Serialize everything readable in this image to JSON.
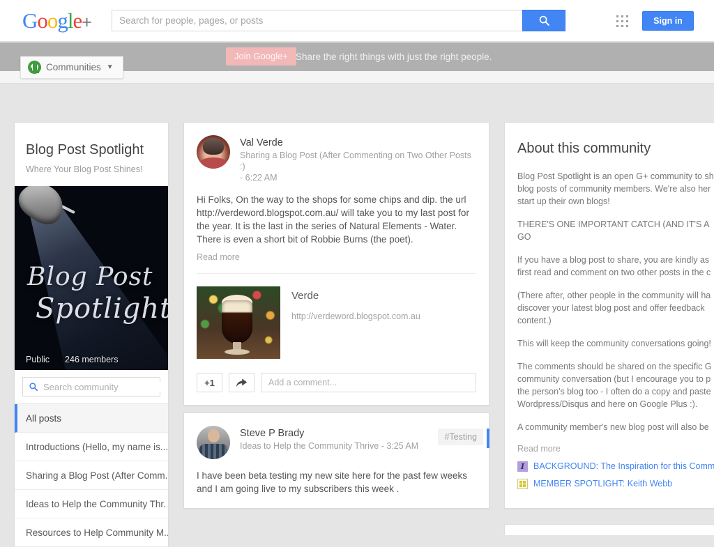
{
  "topbar": {
    "logo_text": "Google",
    "logo_plus": "+",
    "search_placeholder": "Search for people, pages, or posts",
    "search_value": "",
    "search_icon": "search-icon",
    "apps_icon": "apps-grid-icon",
    "signin_label": "Sign in"
  },
  "promo": {
    "join_label": "Join Google+",
    "message": "Share the right things with just the right people."
  },
  "subnav": {
    "communities_label": "Communities",
    "communities_icon": "communities-icon",
    "caret_icon": "chevron-down-icon"
  },
  "community": {
    "title": "Blog Post Spotlight",
    "tagline": "Where Your Blog Post Shines!",
    "banner_line1": "Blog Post",
    "banner_line2": "Spotlight",
    "visibility": "Public",
    "members": "246 members",
    "search_placeholder": "Search community",
    "search_value": "",
    "nav": [
      {
        "label": "All posts",
        "active": true
      },
      {
        "label": "Introductions (Hello, my name is....",
        "active": false
      },
      {
        "label": "Sharing a Blog Post (After Comm.",
        "active": false
      },
      {
        "label": "Ideas to Help the Community Thr.",
        "active": false
      },
      {
        "label": "Resources to Help Community M...",
        "active": false
      }
    ]
  },
  "posts": [
    {
      "author": "Val Verde",
      "category": "Sharing a Blog Post (After Commenting on Two Other Posts :)",
      "time_separator": "-",
      "time": "6:22 AM",
      "body": "Hi Folks,  On the way to the shops for some chips and dip. the url http://verdeword.blogspot.com.au/ will take you to my last post for the year.  It is the last in the series of Natural Elements - Water.  There is even a short bit of Robbie Burns (the poet).",
      "read_more": "Read more",
      "attachment": {
        "title": "Verde",
        "url": "http://verdeword.blogspot.com.au"
      },
      "actions": {
        "plus_one": "+1",
        "share_icon": "share-arrow-icon",
        "comment_placeholder": "Add a comment...",
        "comment_value": ""
      }
    },
    {
      "author": "Steve P Brady",
      "category": "Ideas to Help the Community Thrive",
      "time_separator": "-",
      "time": "3:25 AM",
      "tag": "#Testing",
      "body": "I have been beta testing my new site here for the past few weeks and I am going live to my subscribers this week ."
    }
  ],
  "about": {
    "title": "About this community",
    "paragraphs": [
      "Blog Post Spotlight is an open G+ community to sh blog posts of community members. We're also her start up their own blogs!",
      "THERE'S ONE IMPORTANT CATCH (AND IT'S A GO",
      "If you have a blog post to share, you are kindly as first read and comment on two other posts in the c",
      "(There after, other people in the community will ha discover your latest blog post and offer feedback content.)",
      "This will keep the community conversations going!",
      "The comments should be shared on the specific G community conversation (but I encourage you to p the person's blog too - I often do a copy and paste Wordpress/Disqus and here on Google Plus :).",
      "A community member's new blog post will also be"
    ],
    "read_more": "Read more",
    "links": [
      {
        "icon": "document-icon",
        "label": "BACKGROUND: The Inspiration for this Comm"
      },
      {
        "icon": "member-spotlight-icon",
        "label": "MEMBER SPOTLIGHT: Keith Webb"
      }
    ]
  },
  "colors": {
    "google_blue": "#4285f4",
    "google_red": "#ea4335",
    "google_yellow": "#fbbc05",
    "google_green": "#34a853",
    "promo_bar": "#b0b0b0",
    "page_bg": "#e5e5e5"
  }
}
